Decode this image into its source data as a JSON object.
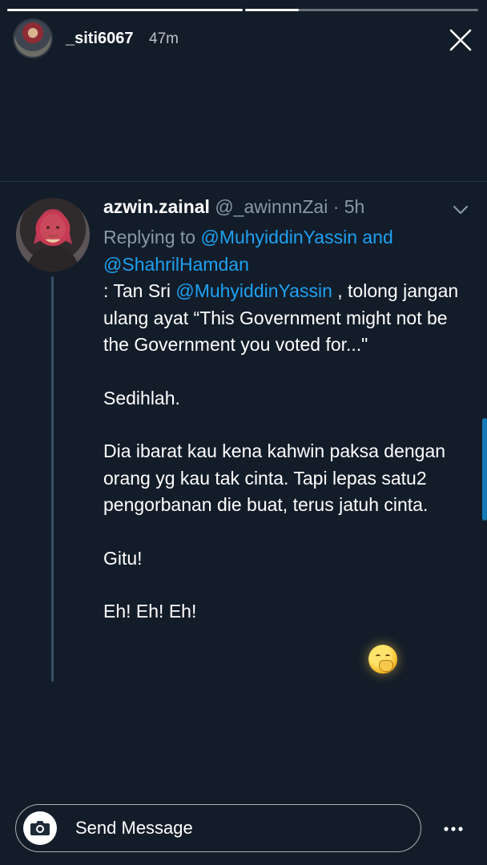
{
  "story": {
    "username": "_siti6067",
    "time_ago": "47m",
    "progress": [
      1.0,
      0.23
    ]
  },
  "tweet": {
    "display_name": "azwin.zainal",
    "handle": "@_awinnnZai",
    "separator": "·",
    "time": "5h",
    "replying_prefix": "Replying to",
    "reply_mention_1": "@MuhyiddinYassin",
    "reply_and": "and",
    "reply_mention_2": "@ShahrilHamdan",
    "body": {
      "line1_prefix": ": Tan Sri ",
      "line1_mention": "@MuhyiddinYassin",
      "line1_rest": " , tolong jangan ulang ayat “This Government might not be the Government you voted for...\"",
      "para2": "Sedihlah.",
      "para3": "Dia ibarat kau kena kahwin paksa dengan orang yg kau tak cinta. Tapi lepas satu2 pengorbanan die buat, terus jatuh cinta.",
      "para4": "Gitu!",
      "para5": "Eh! Eh! Eh!"
    },
    "emoji_icon": "face-with-hand-over-mouth-icon"
  },
  "composer": {
    "placeholder": "Send Message"
  },
  "icons": {
    "close": "close-icon",
    "chevron": "chevron-down-icon",
    "camera": "camera-icon",
    "more": "more-dots-icon"
  },
  "colors": {
    "background": "#131c29",
    "mention": "#1da1f2",
    "muted": "#8899a6"
  }
}
